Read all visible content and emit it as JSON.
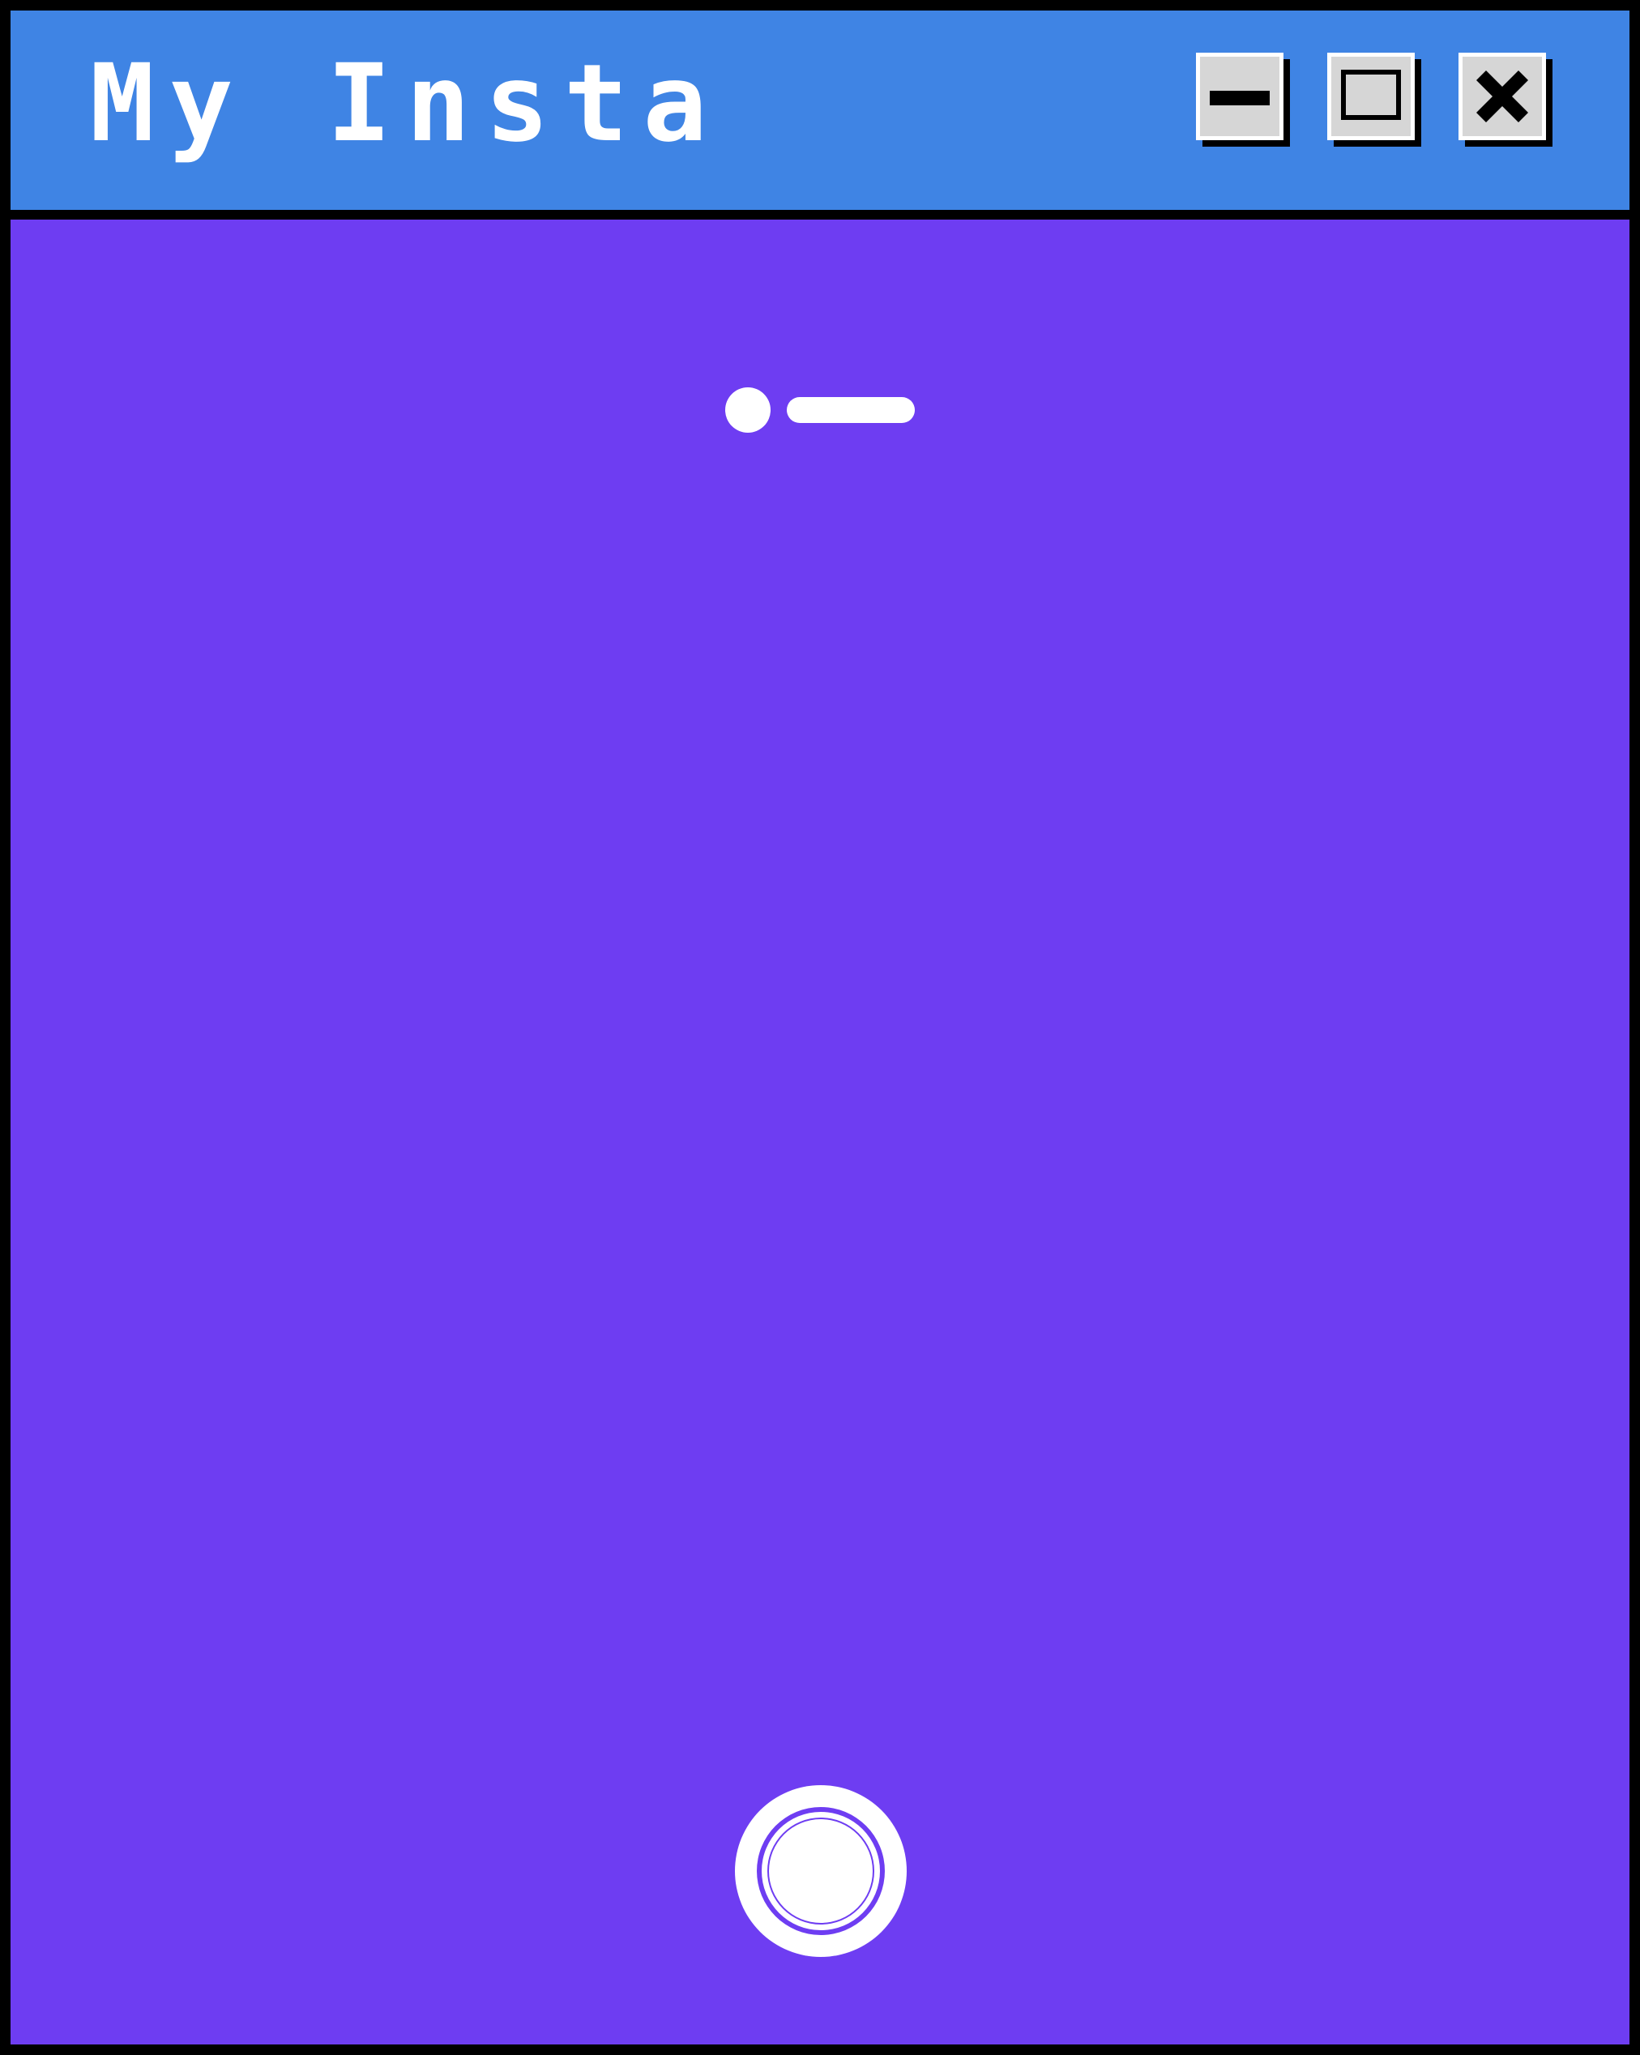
{
  "window": {
    "title": "My Insta",
    "colors": {
      "titlebar": "#3F84E4",
      "content": "#6E3DF2",
      "border": "#000000",
      "button_face": "#D6D6D6",
      "foreground": "#FFFFFF"
    },
    "controls": [
      {
        "name": "minimize",
        "icon": "minimize-icon"
      },
      {
        "name": "maximize",
        "icon": "maximize-icon"
      },
      {
        "name": "close",
        "icon": "close-icon"
      }
    ]
  },
  "camera": {
    "page_indicator": {
      "pages": 2,
      "active_page": 1
    },
    "shutter_icon": "shutter-icon"
  }
}
